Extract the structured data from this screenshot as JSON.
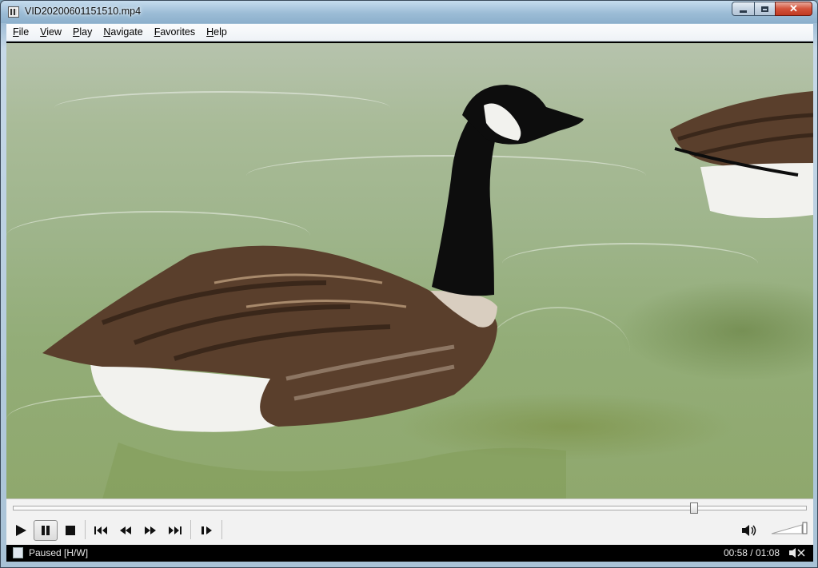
{
  "window": {
    "title": "VID20200601151510.mp4",
    "buttons": {
      "minimize": "minimize",
      "maximize": "maximize",
      "close": "✕"
    }
  },
  "menu": {
    "items": [
      {
        "underline": "F",
        "rest": "ile"
      },
      {
        "underline": "V",
        "rest": "iew"
      },
      {
        "underline": "P",
        "rest": "lay"
      },
      {
        "underline": "N",
        "rest": "avigate"
      },
      {
        "underline": "F",
        "rest": "avorites"
      },
      {
        "underline": "H",
        "rest": "elp"
      }
    ]
  },
  "playback": {
    "position_fraction": 0.859,
    "volume_fraction": 0.9
  },
  "status": {
    "state": "Paused [H/W]",
    "time": "00:58 / 01:08"
  },
  "colors": {
    "water": "#9fb58c",
    "goose_black": "#0d0d0d",
    "goose_brown": "#5a3f2c",
    "goose_white": "#f2f2ee",
    "status_bg": "#000000"
  }
}
